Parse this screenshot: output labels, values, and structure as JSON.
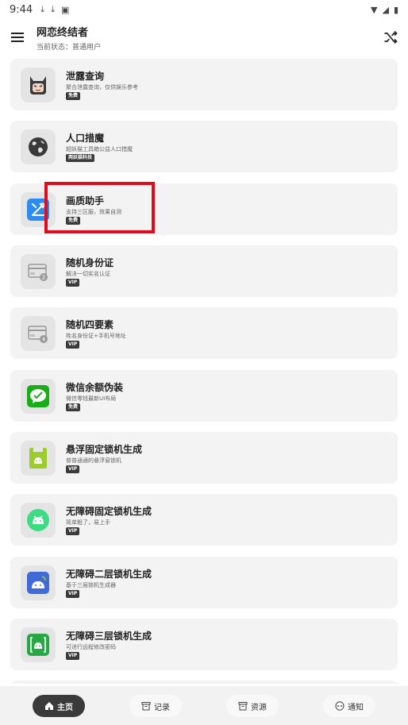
{
  "status_bar": {
    "time": "9:44",
    "left_icons": [
      "download-icon",
      "download-icon",
      "a-icon"
    ],
    "right_icons": [
      "wifi-icon",
      "signal-icon",
      "battery-icon"
    ]
  },
  "header": {
    "title": "网恋终结者",
    "subtitle": "当前状态：普通用户"
  },
  "items": [
    {
      "title": "泄露查询",
      "desc": "聚合泄露查询，仅供娱乐参考",
      "badge": "免费",
      "icon": "devil-icon"
    },
    {
      "title": "人口措魔",
      "desc": "超妖猫工具箱公益人口措魔",
      "badge": "两妖猫科技",
      "icon": "globe-icon"
    },
    {
      "title": "画质助手",
      "desc": "支持三区服，效果自测",
      "badge": "免费",
      "icon": "tools-icon"
    },
    {
      "title": "随机身份证",
      "desc": "解决一切实名认证",
      "badge": "VIP",
      "icon": "id-card-icon"
    },
    {
      "title": "随机四要素",
      "desc": "姓名身份证+手机号地址",
      "badge": "VIP",
      "icon": "id-card-icon"
    },
    {
      "title": "微信余额伪装",
      "desc": "微信零钱最新UI布局",
      "badge": "免费",
      "icon": "wechat-icon"
    },
    {
      "title": "悬浮固定锁机生成",
      "desc": "普普通通的悬浮窗锁机",
      "badge": "VIP",
      "icon": "android-file-icon"
    },
    {
      "title": "无障碍固定锁机生成",
      "desc": "简单粗了，易上手",
      "badge": "VIP",
      "icon": "android-icon"
    },
    {
      "title": "无障碍二层锁机生成",
      "desc": "基于三层锁机生成器",
      "badge": "VIP",
      "icon": "android-blue-icon"
    },
    {
      "title": "无障碍三层锁机生成",
      "desc": "可进行远程修改密码",
      "badge": "VIP",
      "icon": "android-box-icon"
    }
  ],
  "nav": [
    {
      "label": "主页",
      "icon": "home-icon",
      "active": true
    },
    {
      "label": "记录",
      "icon": "archive-icon",
      "active": false
    },
    {
      "label": "资源",
      "icon": "archive-icon",
      "active": false
    },
    {
      "label": "通知",
      "icon": "alien-icon",
      "active": false
    }
  ],
  "colors": {
    "highlight": "#e00b1c",
    "card_bg": "#f3f3f3",
    "badge_bg": "#3a3a3a",
    "tools_blue": "#2d8cf0",
    "wechat_green": "#1aad19",
    "android_green": "#9ccc2e"
  }
}
